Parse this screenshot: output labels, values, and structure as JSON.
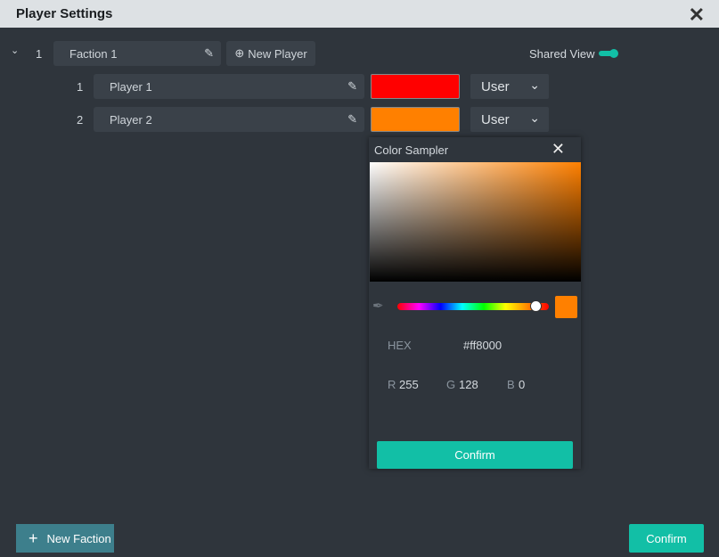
{
  "title": "Player Settings",
  "faction": {
    "index": "1",
    "name": "Faction 1",
    "new_player_label": "New Player"
  },
  "shared_view_label": "Shared View",
  "players": [
    {
      "index": "1",
      "name": "Player 1",
      "color": "#ff0000",
      "role": "User"
    },
    {
      "index": "2",
      "name": "Player 2",
      "color": "#ff8000",
      "role": "User"
    }
  ],
  "color_sampler": {
    "title": "Color Sampler",
    "hex_label": "HEX",
    "hex": "#ff8000",
    "r_label": "R",
    "r": "255",
    "g_label": "G",
    "g": "128",
    "b_label": "B",
    "b": "0",
    "confirm": "Confirm",
    "hue_fraction": 0.92
  },
  "footer": {
    "new_faction": "New Faction",
    "confirm": "Confirm"
  }
}
